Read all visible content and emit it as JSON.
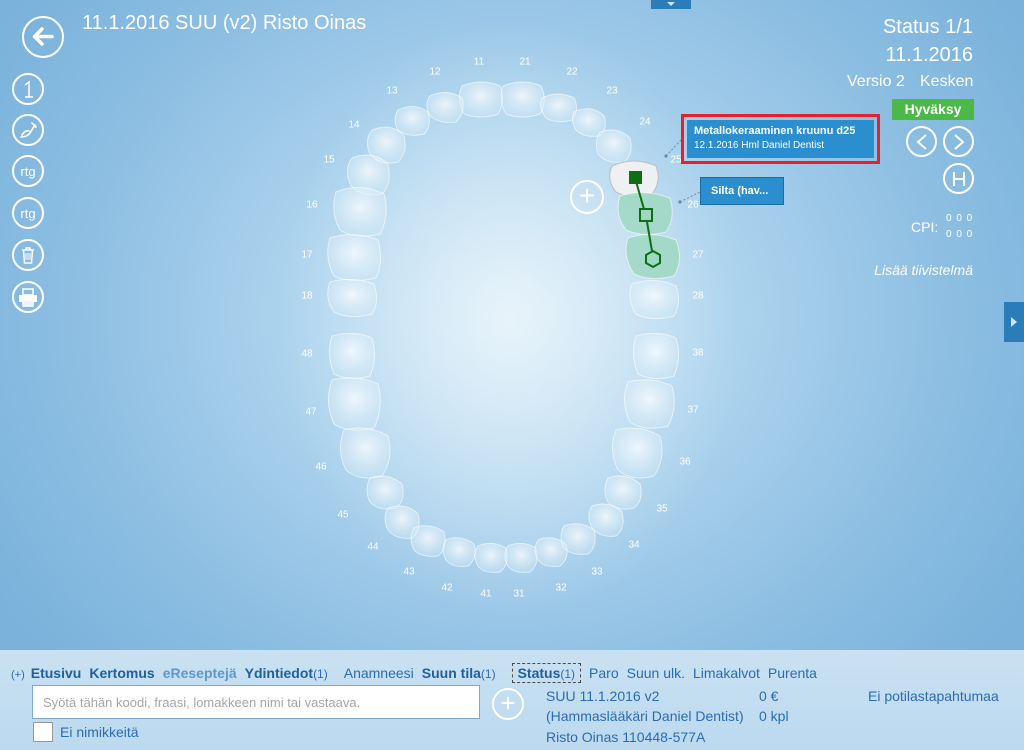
{
  "header": {
    "title": "11.1.2016 SUU (v2) Risto Oinas"
  },
  "tools": {
    "rtg1": "rtg",
    "rtg2": "rtg"
  },
  "status": {
    "title": "Status 1/1",
    "date": "11.1.2016",
    "versio": "Versio 2",
    "state": "Kesken",
    "approve": "Hyväksy",
    "cpi_label": "CPI:",
    "cpi_row1": "0 0 0",
    "cpi_row2": "0 0 0",
    "summary_link": "Lisää tiivistelmä"
  },
  "chart": {
    "upper_numbers": [
      "11",
      "12",
      "13",
      "14",
      "15",
      "16",
      "17",
      "18",
      "21",
      "22",
      "23",
      "24",
      "25",
      "26",
      "27",
      "28"
    ],
    "lower_numbers": [
      "31",
      "32",
      "33",
      "34",
      "35",
      "36",
      "37",
      "38",
      "41",
      "42",
      "43",
      "44",
      "45",
      "46",
      "47",
      "48"
    ],
    "callout1_title": "Metallokeraaminen kruunu d25",
    "callout1_sub": "12.1.2016 Hml Daniel Dentist",
    "callout2": "Silta (hav..."
  },
  "tabs": {
    "plus": "(+)",
    "etusivu": "Etusivu",
    "kertomus": "Kertomus",
    "ereseptit": "eReseptejä",
    "ydintiedot": "Ydintiedot",
    "ydintiedot_count": "(1)",
    "anamneesi": "Anamneesi",
    "suun_tila": "Suun tila",
    "suun_tila_count": "(1)",
    "status": "Status",
    "status_count": "(1)",
    "paro": "Paro",
    "suun_ulk": "Suun ulk.",
    "limakalvot": "Limakalvot",
    "purenta": "Purenta"
  },
  "command": {
    "placeholder": "Syötä tähän koodi, fraasi, lomakkeen nimi tai vastaava.",
    "checkbox_label": "Ei nimikkeitä"
  },
  "visit": {
    "line1": "SUU 11.1.2016 v2",
    "line2": "(Hammaslääkäri Daniel Dentist)",
    "line3": "Risto Oinas 110448-577A",
    "cost": "0 €",
    "count": "0 kpl",
    "events": "Ei potilastapahtumaa"
  },
  "colors": {
    "accent": "#2b8fcf",
    "approve": "#4cb848",
    "highlight": "#e8202a",
    "bridge": "#0d6e12"
  }
}
